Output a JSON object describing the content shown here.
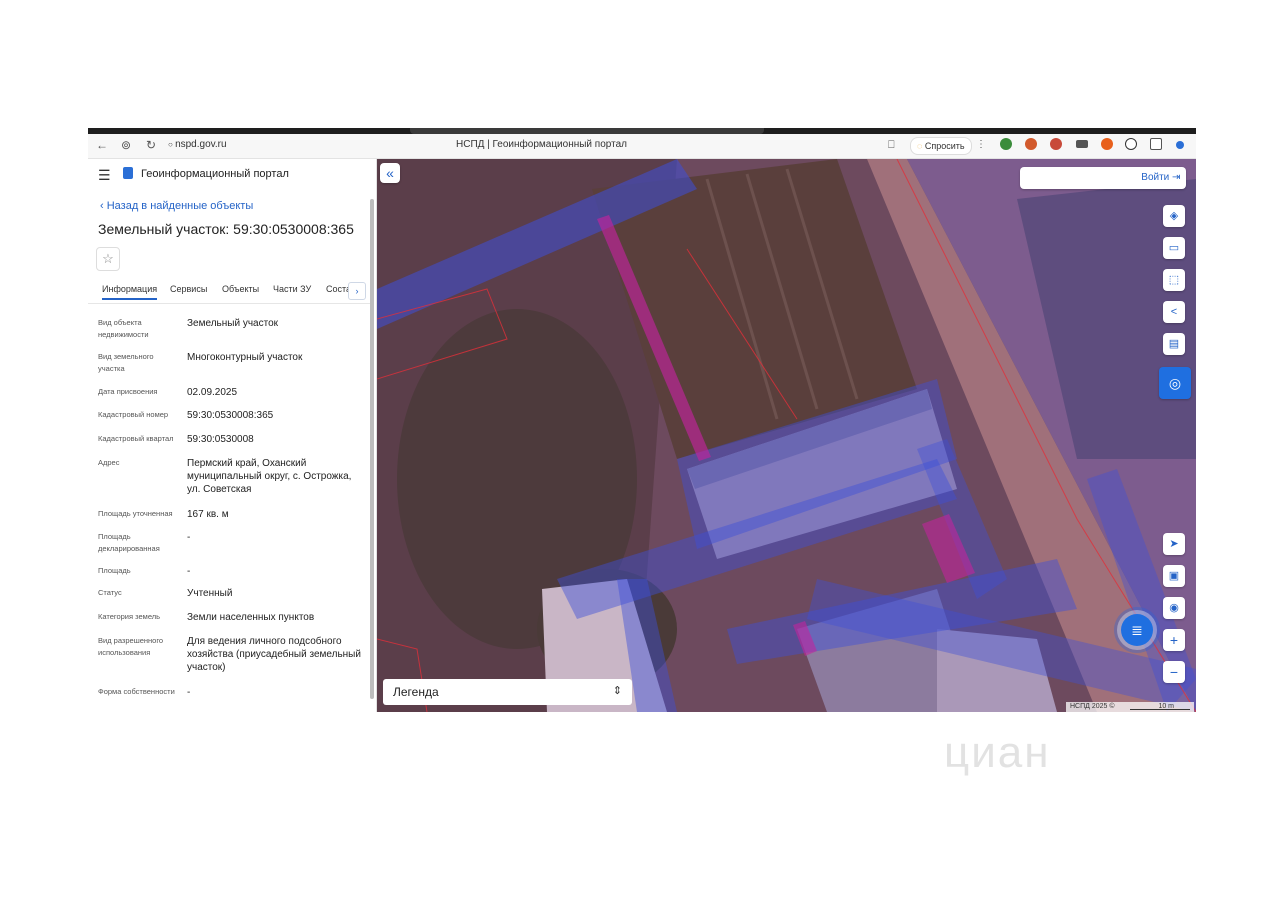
{
  "browser": {
    "url": "nspd.gov.ru",
    "page_title": "НСПД | Геоинформационный портал",
    "ask_label": "Спросить",
    "nav_back": "←",
    "nav_shield": "⊚",
    "nav_reload": "↻",
    "lock": "🔒",
    "bookmark": "⎕"
  },
  "sidebar": {
    "menu_icon": "☰",
    "portal_name": "Геоинформационный портал",
    "back_link": "‹  Назад в найденные объекты",
    "title": "Земельный участок: 59:30:0530008:365",
    "favorite_icon": "☆",
    "tabs": [
      "Информация",
      "Сервисы",
      "Объекты",
      "Части ЗУ",
      "Соста"
    ],
    "tabs_more": "›",
    "properties": [
      {
        "label": "Вид объекта недвижимости",
        "value": "Земельный участок"
      },
      {
        "label": "Вид земельного участка",
        "value": "Многоконтурный участок"
      },
      {
        "label": "Дата присвоения",
        "value": "02.09.2025"
      },
      {
        "label": "Кадастровый номер",
        "value": "59:30:0530008:365"
      },
      {
        "label": "Кадастровый квартал",
        "value": "59:30:0530008"
      },
      {
        "label": "Адрес",
        "value": "Пермский край, Оханский муниципальный округ, с. Острожка, ул. Советская"
      },
      {
        "label": "Площадь уточненная",
        "value": "167 кв. м"
      },
      {
        "label": "Площадь декларированная",
        "value": "-"
      },
      {
        "label": "Площадь",
        "value": "-"
      },
      {
        "label": "Статус",
        "value": "Учтенный"
      },
      {
        "label": "Категория земель",
        "value": "Земли населенных пунктов"
      },
      {
        "label": "Вид разрешенного использования",
        "value": "Для ведения личного подсобного хозяйства (приусадебный земельный участок)"
      },
      {
        "label": "Форма собственности",
        "value": "-"
      }
    ]
  },
  "map": {
    "collapse_icon": "«",
    "login_label": "Войти",
    "login_icon": "⇥",
    "tools": [
      "layers-icon",
      "ruler-icon",
      "select-area-icon",
      "share-icon",
      "print-icon",
      "assistant-icon"
    ],
    "nav_tools": [
      "locate-icon",
      "minimap-icon",
      "geolocation-icon",
      "zoom-in-icon",
      "zoom-out-icon"
    ],
    "zoom_in": "+",
    "zoom_out": "−",
    "legend_label": "Легенда",
    "legend_icon": "⇕",
    "scale_text": "НСПД 2025 ©",
    "scale_value": "10 m",
    "chat_icon": "≣"
  },
  "watermark": "циан",
  "colors": {
    "accent": "#2463c7",
    "map_tint": "#7a4a6e",
    "parcel_blue": "#3e4fd8",
    "parcel_magenta": "#c2249c",
    "boundary_red": "#e0303a"
  }
}
